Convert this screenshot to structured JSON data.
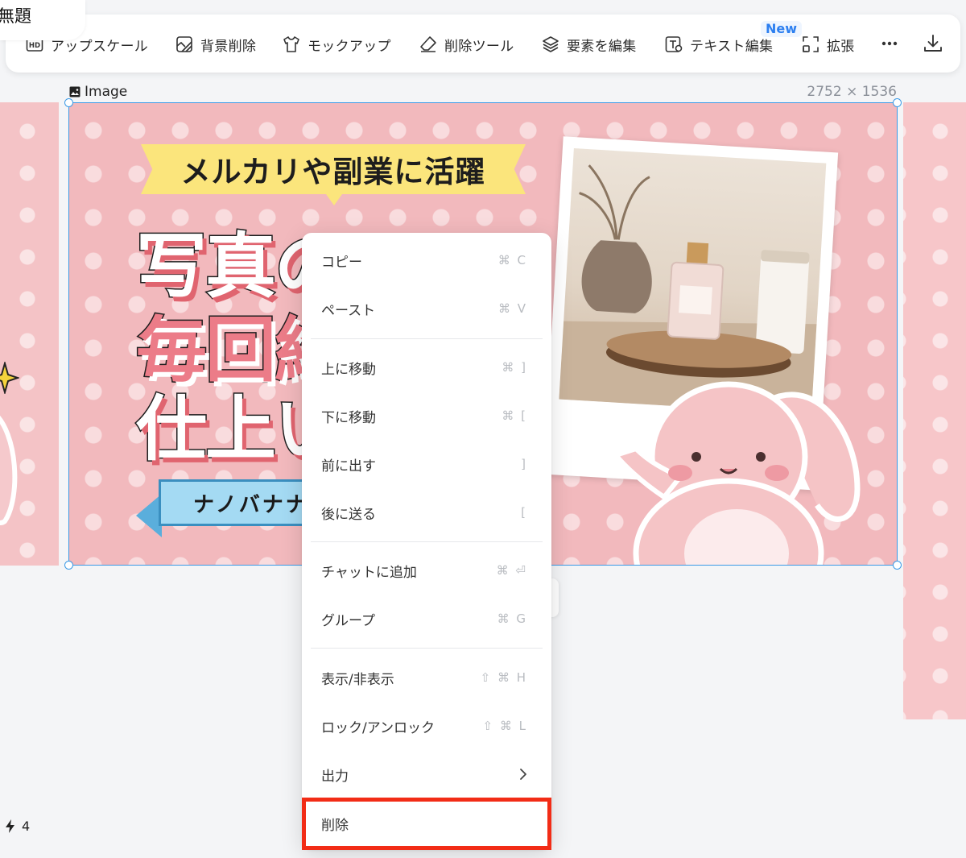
{
  "document": {
    "title": "無題"
  },
  "toolbar": {
    "items": [
      {
        "label": "アップスケール",
        "icon": "hd-icon"
      },
      {
        "label": "背景削除",
        "icon": "remove-bg-icon"
      },
      {
        "label": "モックアップ",
        "icon": "tshirt-icon"
      },
      {
        "label": "削除ツール",
        "icon": "eraser-icon"
      },
      {
        "label": "要素を編集",
        "icon": "layers-icon"
      },
      {
        "label": "テキスト編集",
        "icon": "text-edit-icon"
      },
      {
        "label": "拡張",
        "icon": "expand-icon"
      }
    ],
    "new_badge": "New",
    "more_icon": "more-horizontal-icon",
    "download_icon": "download-icon"
  },
  "canvas": {
    "element_label": "Image",
    "dimensions": "2752 × 1536",
    "design": {
      "banner_text": "メルカリや副業に活躍",
      "headline_line1": "写真の",
      "headline_line2": "毎回綺",
      "headline_line3": "仕上い",
      "ribbon_text": "ナノバナナで"
    }
  },
  "context_menu": {
    "items": [
      {
        "label": "コピー",
        "shortcut": "⌘ C"
      },
      {
        "label": "ペースト",
        "shortcut": "⌘ V"
      },
      {
        "label": "上に移動",
        "shortcut": "⌘ ]"
      },
      {
        "label": "下に移動",
        "shortcut": "⌘ ["
      },
      {
        "label": "前に出す",
        "shortcut": "]"
      },
      {
        "label": "後に送る",
        "shortcut": "["
      },
      {
        "label": "チャットに追加",
        "shortcut": "⌘ ⏎"
      },
      {
        "label": "グループ",
        "shortcut": "⌘ G"
      },
      {
        "label": "表示/非表示",
        "shortcut": "⇧ ⌘ H"
      },
      {
        "label": "ロック/アンロック",
        "shortcut": "⇧ ⌘ L"
      },
      {
        "label": "出力",
        "shortcut": ""
      },
      {
        "label": "削除",
        "shortcut": ""
      }
    ],
    "highlighted_item": "削除",
    "highlight_color": "#f22c16"
  },
  "credits": {
    "count": "4",
    "icon": "bolt-icon"
  },
  "colors": {
    "selection": "#3b9ae6",
    "canvas_pink": "#f2b9bd",
    "badge_blue": "#2c7ff0"
  }
}
